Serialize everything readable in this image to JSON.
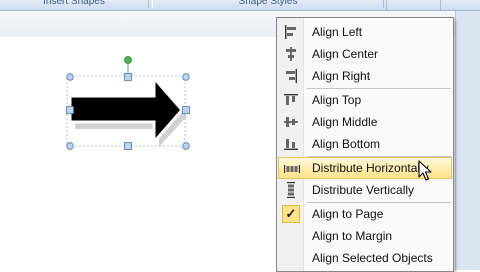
{
  "ribbon": {
    "insert_shapes_label": "Insert Shapes",
    "shape_styles_label": "Shape Styles"
  },
  "menu": {
    "items": [
      {
        "label": "Align Left",
        "icon": "align-left-icon"
      },
      {
        "label": "Align Center",
        "icon": "align-center-icon"
      },
      {
        "label": "Align Right",
        "icon": "align-right-icon"
      },
      {
        "label": "Align Top",
        "icon": "align-top-icon"
      },
      {
        "label": "Align Middle",
        "icon": "align-middle-icon"
      },
      {
        "label": "Align Bottom",
        "icon": "align-bottom-icon"
      },
      {
        "label": "Distribute Horizontally",
        "icon": "distribute-horizontally-icon",
        "highlighted": true
      },
      {
        "label": "Distribute Vertically",
        "icon": "distribute-vertically-icon"
      },
      {
        "label": "Align to Page",
        "icon": "checkmark-icon",
        "checked": true
      },
      {
        "label": "Align to Margin"
      },
      {
        "label": "Align Selected Objects"
      }
    ]
  },
  "colors": {
    "highlight": "#ffe48b",
    "shape_fill": "#000000",
    "handle": "#a7c3e6",
    "rotation_handle": "#45b649"
  }
}
